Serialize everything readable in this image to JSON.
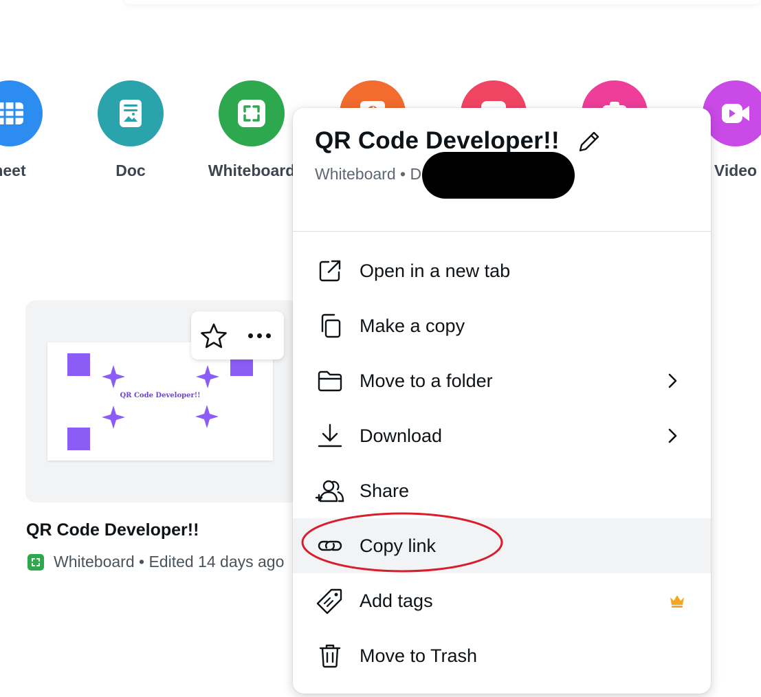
{
  "design_types": [
    {
      "label": "heet",
      "color": "#2d8cf0",
      "icon": "spreadsheet-icon"
    },
    {
      "label": "Doc",
      "color": "#2aa3ad",
      "icon": "doc-icon"
    },
    {
      "label": "Whiteboard",
      "color": "#2ea84f",
      "icon": "whiteboard-icon"
    },
    {
      "label": "",
      "color": "#f26b2f",
      "icon": "presentation-icon"
    },
    {
      "label": "",
      "color": "#ef4563",
      "icon": "social-icon"
    },
    {
      "label": "",
      "color": "#ee3e9a",
      "icon": "photo-icon"
    },
    {
      "label": "Video",
      "color": "#c94ae6",
      "icon": "video-icon"
    }
  ],
  "card": {
    "thumbnail_title": "QR Code Developer!!",
    "title": "QR Code Developer!!",
    "meta": "Whiteboard • Edited 14 days ago"
  },
  "menu": {
    "title": "QR Code Developer!!",
    "subtitle": "Whiteboard • D              Edited 14 days ago",
    "items": [
      {
        "label": "Open in a new tab",
        "icon": "external-link-icon"
      },
      {
        "label": "Make a copy",
        "icon": "copy-icon"
      },
      {
        "label": "Move to a folder",
        "icon": "folder-icon",
        "submenu": true
      },
      {
        "label": "Download",
        "icon": "download-icon",
        "submenu": true
      },
      {
        "label": "Share",
        "icon": "share-icon"
      },
      {
        "label": "Copy link",
        "icon": "link-icon",
        "highlighted": true
      },
      {
        "label": "Add tags",
        "icon": "tag-icon",
        "premium": true
      },
      {
        "label": "Move to Trash",
        "icon": "trash-icon"
      }
    ]
  },
  "colors": {
    "accent_purple": "#8b5cf6",
    "annotation_red": "#d81e2c",
    "premium_crown": "#f5a623"
  }
}
